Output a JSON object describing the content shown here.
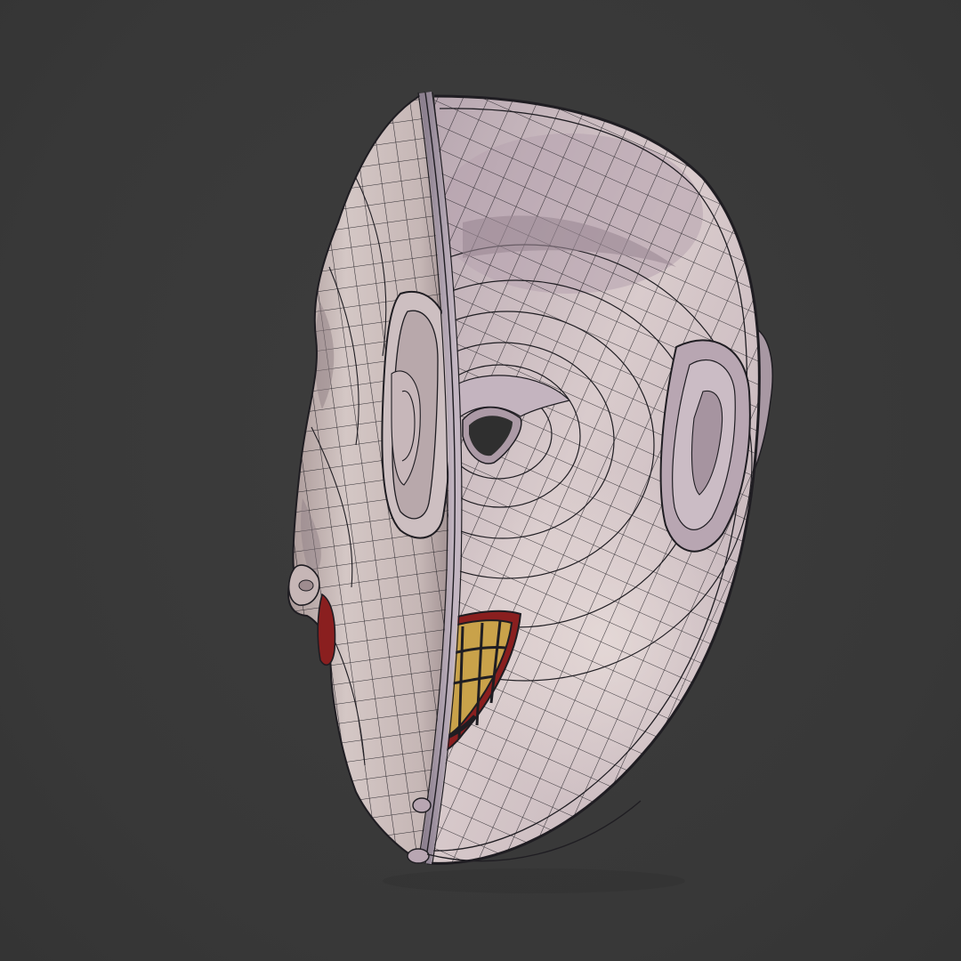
{
  "scene": {
    "subject": "mask-wireframe-render",
    "colors": {
      "background": "#3a3a3a",
      "skin_light": "#d8ccca",
      "skin_mid": "#b9a9a8",
      "skin_shadow": "#8f7f84",
      "skin_inner": "#c9b8c2",
      "wire": "#1f1d22",
      "lips": "#8a1f1f",
      "teeth": "#c9a24a",
      "eye_hole": "#2f2f2f"
    }
  }
}
